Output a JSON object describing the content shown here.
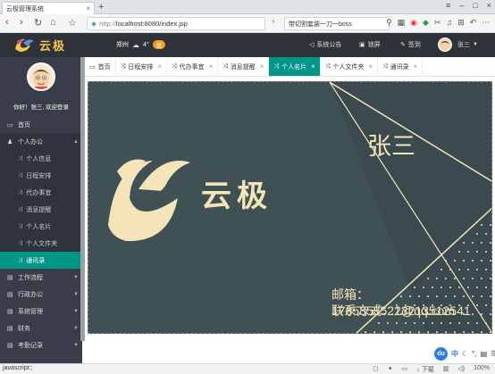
{
  "browser": {
    "tab_title": "云极管理系统",
    "url_scheme": "http://",
    "url_rest": "localhost:8080/index.jsp",
    "search_text": "带切割套装一刀一boss",
    "zoom": "100%",
    "download_label": "下载",
    "status_text": "javascript:;"
  },
  "header": {
    "brand": "云极",
    "city": "郑州",
    "temperature": "4°",
    "weather_badge": "良",
    "notice": "系统公告",
    "lock": "锁屏",
    "signin": "签到",
    "username": "张三"
  },
  "sidebar": {
    "welcome": "你好！张三, 欢迎登录",
    "items": [
      {
        "label": "首页",
        "icon": "monitor-icon",
        "type": "top"
      },
      {
        "label": "个人办公",
        "icon": "user-icon",
        "type": "open"
      },
      {
        "label": "个人信息",
        "type": "sub"
      },
      {
        "label": "日程安排",
        "type": "sub"
      },
      {
        "label": "代办事宜",
        "type": "sub"
      },
      {
        "label": "消息提醒",
        "type": "sub"
      },
      {
        "label": "个人名片",
        "type": "sub"
      },
      {
        "label": "个人文件夹",
        "type": "sub"
      },
      {
        "label": "通讯录",
        "type": "sub-active"
      },
      {
        "label": "工作流程",
        "icon": "folder-icon",
        "type": "top"
      },
      {
        "label": "行政办公",
        "icon": "folder-icon",
        "type": "top"
      },
      {
        "label": "系统管理",
        "icon": "folder-icon",
        "type": "top"
      },
      {
        "label": "财务",
        "icon": "folder-icon",
        "type": "top"
      },
      {
        "label": "考勤记录",
        "icon": "folder-icon",
        "type": "top"
      }
    ]
  },
  "content_tabs": [
    {
      "label": "首页",
      "closable": false,
      "active": false
    },
    {
      "label": "日程安排",
      "closable": true,
      "active": false
    },
    {
      "label": "代办事宜",
      "closable": true,
      "active": false
    },
    {
      "label": "消息提醒",
      "closable": true,
      "active": false
    },
    {
      "label": "个人名片",
      "closable": true,
      "active": true
    },
    {
      "label": "个人文件夹",
      "closable": true,
      "active": false
    },
    {
      "label": "通讯录",
      "closable": true,
      "active": false
    }
  ],
  "card": {
    "brand": "云极",
    "name": "张三",
    "email": "邮箱：1785358522@qq.com",
    "phone": "联系方式：13213512541"
  },
  "ime": {
    "logo": "du",
    "lang": "中"
  },
  "colors": {
    "accent": "#009688",
    "sidebar": "#393d49",
    "header": "#2d3338",
    "card_bg": "#3f5155",
    "card_fg": "#f4e4b8"
  }
}
